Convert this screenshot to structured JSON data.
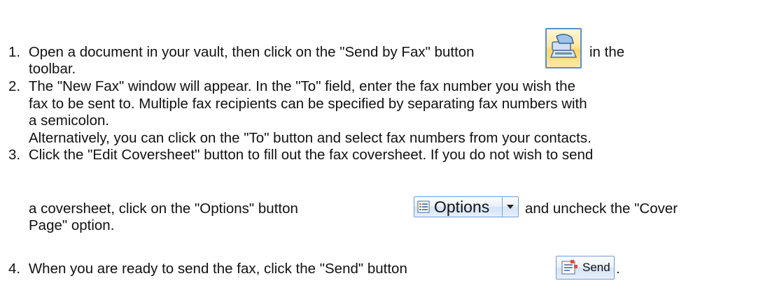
{
  "steps": [
    {
      "num": "1.",
      "part1": "Open a document in your vault, then click on the \"Send by Fax\" button",
      "part2": "in the",
      "cont": "toolbar."
    },
    {
      "num": "2.",
      "text": "The \"New Fax\" window will appear. In the \"To\" field, enter the fax number you wish the",
      "cont1": "fax to be sent to. Multiple fax recipients can be specified by separating fax numbers with",
      "cont2": "a semicolon.",
      "cont3": "Alternatively, you can click on the \"To\" button and select fax numbers from your contacts."
    },
    {
      "num": "3.",
      "text": "Click the \"Edit Coversheet\" button to fill out the fax coversheet. If you do not wish to send",
      "cont1a": "a coversheet, click on the \"Options\" button",
      "cont1b": "and uncheck the \"Cover",
      "cont2": "Page\" option."
    },
    {
      "num": "4.",
      "text": "When you are ready to send the fax, click the \"Send\" button",
      "end": "."
    }
  ],
  "buttons": {
    "options_label": "Options",
    "send_label": "Send"
  },
  "icons": {
    "fax": "fax-machine-icon",
    "options": "options-list-icon",
    "dropdown": "chevron-down-icon",
    "send": "send-document-icon"
  }
}
